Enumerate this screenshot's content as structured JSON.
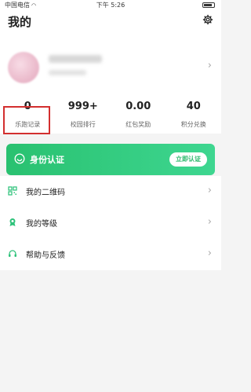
{
  "status_bar": {
    "carrier": "中国电信",
    "time": "下午 5:26"
  },
  "header": {
    "title": "我的"
  },
  "stats": [
    {
      "value": "0",
      "label": "乐跑记录"
    },
    {
      "value": "999+",
      "label": "校园排行"
    },
    {
      "value": "0.00",
      "label": "红包奖励"
    },
    {
      "value": "40",
      "label": "积分兑换"
    }
  ],
  "identity": {
    "label": "身份认证",
    "button": "立即认证"
  },
  "menu": [
    {
      "label": "我的二维码",
      "icon": "qrcode-icon"
    },
    {
      "label": "我的等级",
      "icon": "level-badge-icon"
    },
    {
      "label": "帮助与反馈",
      "icon": "headset-icon"
    }
  ],
  "colors": {
    "accent": "#2ec27a",
    "highlight": "#d32f2f"
  }
}
